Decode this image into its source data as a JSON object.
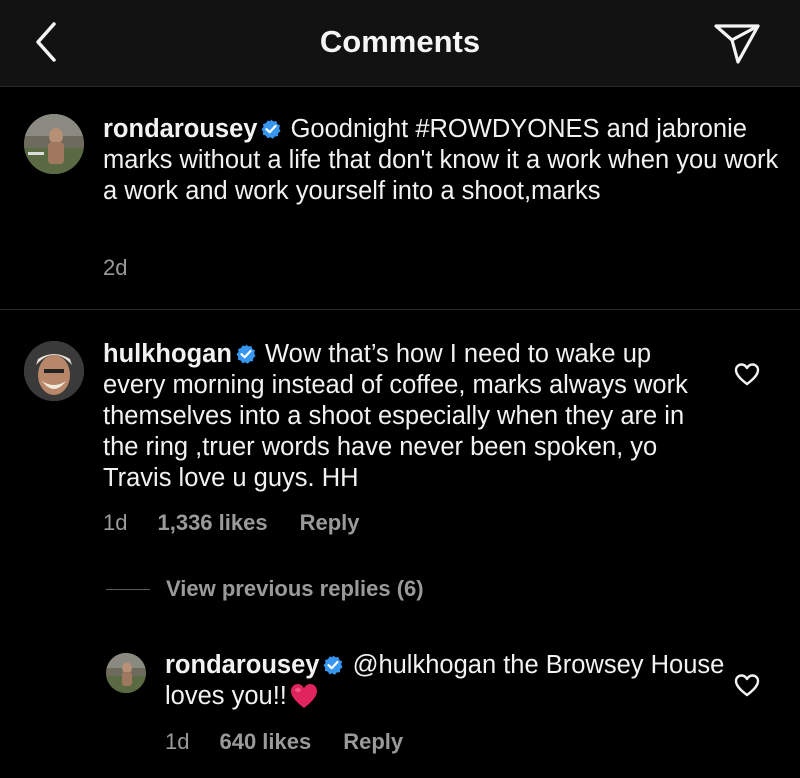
{
  "header": {
    "title": "Comments",
    "back_icon": "chevron-left-icon",
    "share_icon": "paper-plane-icon"
  },
  "caption": {
    "username": "rondarousey",
    "text": "Goodnight #ROWDYONES and jabronie marks without a life that don't know it a work when you work a work and work yourself into a shoot,marks",
    "time": "2d"
  },
  "comment": {
    "username": "hulkhogan",
    "text": "Wow that’s how I need to wake up every morning instead of coffee, marks always work themselves into a shoot especially when they are in the ring ,truer words have never been spoken, yo Travis love u guys. HH",
    "time": "1d",
    "likes": "1,336 likes",
    "reply_label": "Reply"
  },
  "view_previous": {
    "label": "View previous replies (6)"
  },
  "reply": {
    "username": "rondarousey",
    "text": "@hulkhogan the Browsey House loves you!!",
    "emoji": "red-heart-icon",
    "time": "1d",
    "likes": "640 likes",
    "reply_label": "Reply"
  },
  "colors": {
    "background": "#000000",
    "header_background": "#121212",
    "text_primary": "#f2f2f2",
    "text_secondary": "#9a9a9a",
    "verified_blue": "#3797f0",
    "heart_red": "#e0245e"
  }
}
